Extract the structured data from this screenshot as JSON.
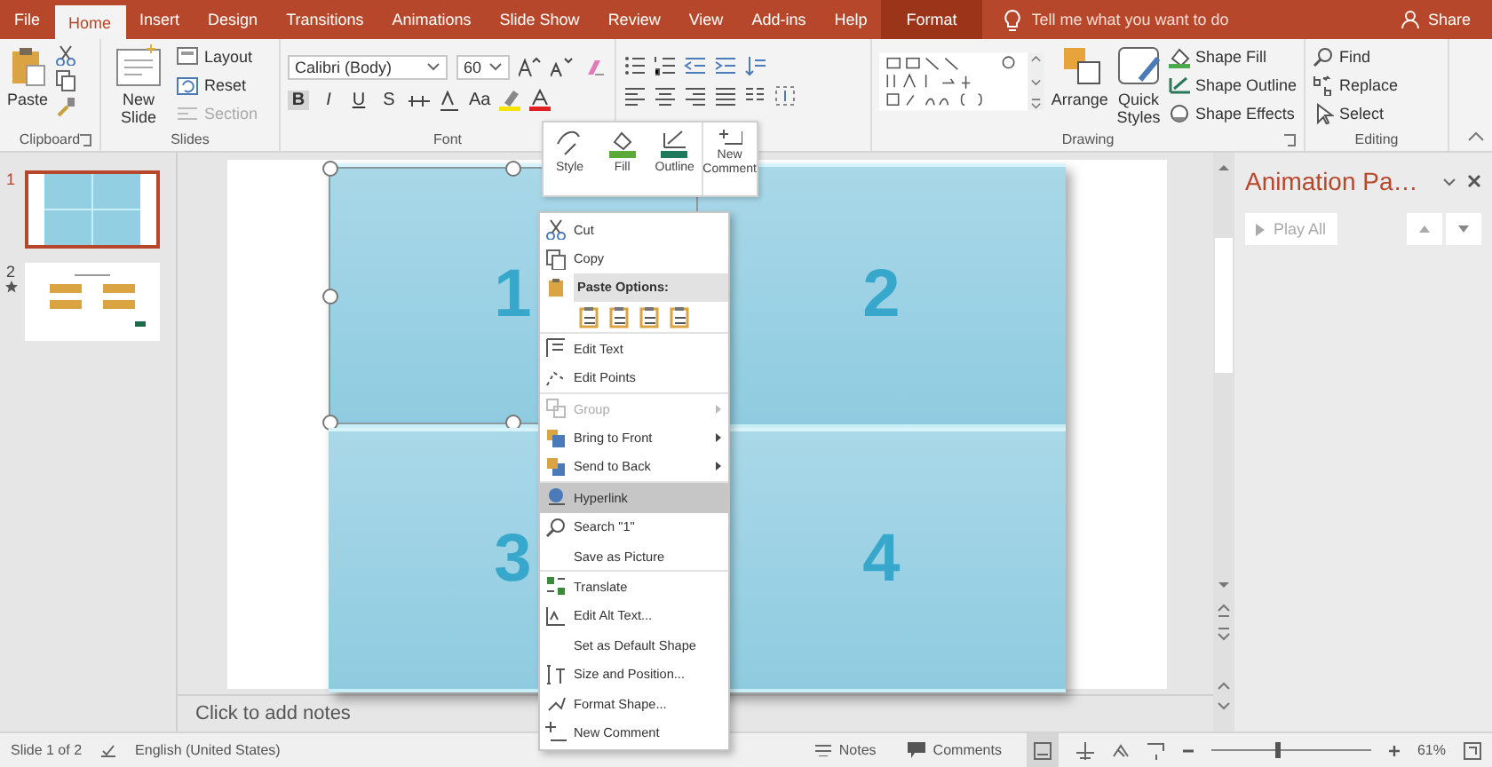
{
  "tabs": [
    {
      "label": "File",
      "selected": false,
      "kind": "normal"
    },
    {
      "label": "Home",
      "selected": true,
      "kind": "normal"
    },
    {
      "label": "Insert",
      "selected": false,
      "kind": "normal"
    },
    {
      "label": "Design",
      "selected": false,
      "kind": "normal"
    },
    {
      "label": "Transitions",
      "selected": false,
      "kind": "normal"
    },
    {
      "label": "Animations",
      "selected": false,
      "kind": "normal"
    },
    {
      "label": "Slide Show",
      "selected": false,
      "kind": "normal"
    },
    {
      "label": "Review",
      "selected": false,
      "kind": "normal"
    },
    {
      "label": "View",
      "selected": false,
      "kind": "normal"
    },
    {
      "label": "Add-ins",
      "selected": false,
      "kind": "normal"
    },
    {
      "label": "Help",
      "selected": false,
      "kind": "normal"
    },
    {
      "label": "Format",
      "selected": false,
      "kind": "contextual"
    }
  ],
  "tell_me": {
    "placeholder": "Tell me what you want to do"
  },
  "share": "Share",
  "ribbon": {
    "clipboard": {
      "paste": "Paste",
      "label": "Clipboard"
    },
    "slides": {
      "new_slide": "New Slide",
      "buttons": [
        {
          "label": "Layout",
          "disabled": false
        },
        {
          "label": "Reset",
          "disabled": false
        },
        {
          "label": "Section",
          "disabled": true
        }
      ],
      "label": "Slides"
    },
    "font": {
      "font_name": "Calibri (Body)",
      "font_size": "60",
      "styles": [
        "B",
        "I",
        "U",
        "S"
      ],
      "change_case": "Aa",
      "label": "Font"
    },
    "drawing": {
      "arrange": "Arrange",
      "quick_styles": "Quick Styles",
      "shape_fill": "Shape Fill",
      "shape_outline": "Shape Outline",
      "shape_effects": "Shape Effects",
      "label": "Drawing"
    },
    "editing": {
      "find": "Find",
      "replace": "Replace",
      "select": "Select",
      "label": "Editing"
    }
  },
  "slides": [
    {
      "number": "1",
      "selected": true,
      "animated": false
    },
    {
      "number": "2",
      "selected": false,
      "animated": true
    }
  ],
  "slide": {
    "shapes": [
      {
        "label": "1",
        "selected": true
      },
      {
        "label": "2",
        "selected": false
      },
      {
        "label": "3",
        "selected": false
      },
      {
        "label": "4",
        "selected": false
      }
    ]
  },
  "notes_placeholder": "Click to add notes",
  "mini_toolbar": [
    {
      "label": "Style",
      "kind": "style"
    },
    {
      "label": "Fill",
      "kind": "fill"
    },
    {
      "label": "Outline",
      "kind": "outline"
    },
    {
      "label": "New Comment",
      "kind": "comment"
    }
  ],
  "context_menu": [
    [
      {
        "label": "Cut",
        "kind": "item",
        "disabled": false,
        "submenu": false,
        "selected": false
      },
      {
        "label": "Copy",
        "kind": "item",
        "disabled": false,
        "submenu": false,
        "selected": false
      },
      {
        "label": "Paste Options:",
        "kind": "header"
      },
      {
        "kind": "paste_options"
      }
    ],
    [
      {
        "label": "Edit Text",
        "kind": "item",
        "disabled": false,
        "submenu": false,
        "selected": false
      },
      {
        "label": "Edit Points",
        "kind": "item",
        "disabled": false,
        "submenu": false,
        "selected": false
      }
    ],
    [
      {
        "label": "Group",
        "kind": "item",
        "disabled": true,
        "submenu": true,
        "selected": false
      },
      {
        "label": "Bring to Front",
        "kind": "item",
        "disabled": false,
        "submenu": true,
        "selected": false
      },
      {
        "label": "Send to Back",
        "kind": "item",
        "disabled": false,
        "submenu": true,
        "selected": false
      }
    ],
    [
      {
        "label": "Hyperlink",
        "kind": "item",
        "disabled": false,
        "submenu": false,
        "selected": true
      },
      {
        "label": "Search \"1\"",
        "kind": "item",
        "disabled": false,
        "submenu": false,
        "selected": false
      },
      {
        "label": "Save as Picture",
        "kind": "item",
        "disabled": false,
        "submenu": false,
        "selected": false
      }
    ],
    [
      {
        "label": "Translate",
        "kind": "item",
        "disabled": false,
        "submenu": false,
        "selected": false
      },
      {
        "label": "Edit Alt Text...",
        "kind": "item",
        "disabled": false,
        "submenu": false,
        "selected": false
      },
      {
        "label": "Set as Default Shape",
        "kind": "item",
        "disabled": false,
        "submenu": false,
        "selected": false
      },
      {
        "label": "Size and Position...",
        "kind": "item",
        "disabled": false,
        "submenu": false,
        "selected": false
      },
      {
        "label": "Format Shape...",
        "kind": "item",
        "disabled": false,
        "submenu": false,
        "selected": false
      },
      {
        "label": "New Comment",
        "kind": "item",
        "disabled": false,
        "submenu": false,
        "selected": false
      }
    ]
  ],
  "animation_pane": {
    "title": "Animation Pa…",
    "play_all": {
      "label": "Play All",
      "disabled": true
    }
  },
  "status_bar": {
    "slide_info": "Slide 1 of 2",
    "language": "English (United States)",
    "notes": "Notes",
    "comments": "Comments",
    "zoom": {
      "level": 0.4
    },
    "zoom_reading": "61%"
  }
}
